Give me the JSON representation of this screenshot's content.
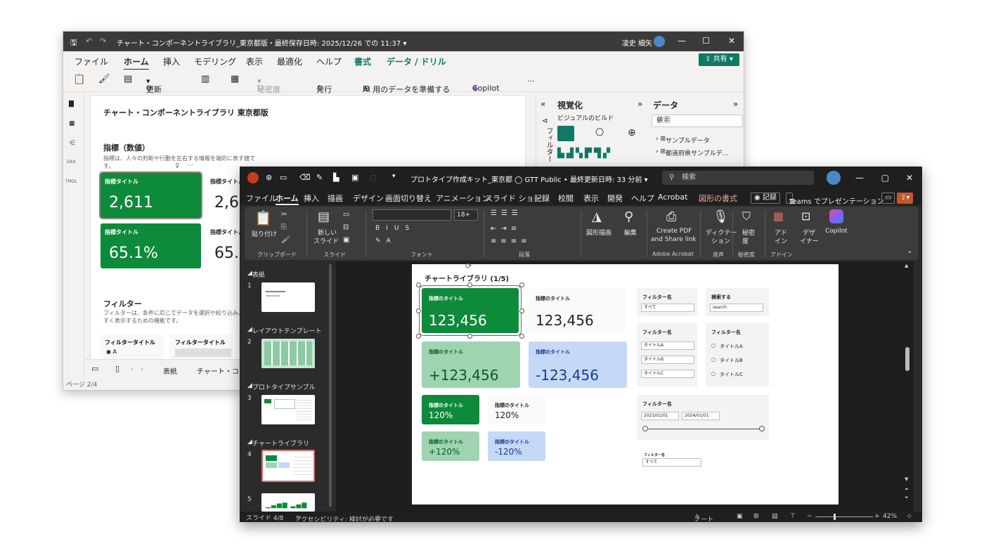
{
  "pbi": {
    "title": "チャート・コンポーネントライブラリ_東京都版・最終保存日時: 2025/12/26 での 11:37 ▾",
    "user": "凌史 細矢",
    "menu": [
      "ファイル",
      "ホーム",
      "挿入",
      "モデリング",
      "表示",
      "最適化",
      "ヘルプ",
      "書式",
      "データ / ドリル"
    ],
    "share": "共有",
    "ribbon": {
      "refresh": "更新",
      "sensitivity": "秘密度",
      "publish": "発行",
      "prepare_ai": "AI 用のデータを準備する",
      "copilot": "Copilot",
      "more": "···"
    },
    "left_nav": [
      "report-icon",
      "table-icon",
      "model-icon",
      "dax-icon",
      "tmdl-icon"
    ],
    "left_nav_labels": {
      "dax": "DAX",
      "tmdl": "TMDL"
    },
    "canvas": {
      "title": "チャート・コンポーネントライブラリ 東京都版",
      "kpi_heading": "指標（数値）",
      "kpi_desc": "指標は、人々の判断や行動を左右する情報を端的に表す値です。",
      "kpi_label": "指標タイトル",
      "kpi1_value": "2,611",
      "kpi2_value": "2,61",
      "kpi3_value": "65.1%",
      "kpi4_value": "65.1",
      "filter_heading": "フィルター",
      "filter_desc": "フィルターは、条件に応じてデータを選択や絞り込み、見やすく表示するための機能です。",
      "filter_title_1": "フィルタータイトル",
      "filter_title_2": "フィルタータイトル",
      "radio_a": "A",
      "visual_more": "···"
    },
    "right_panel": {
      "visual_title": "視覚化",
      "build_visual": "ビジュアルのビルド",
      "filter_vertical": "フィルター",
      "data_title": "データ",
      "search_placeholder": "検索",
      "tables": [
        "サンプルデータ",
        "都道府県サンプルデ..."
      ]
    },
    "bottom_tabs": [
      "表紙",
      "チャート・コン"
    ],
    "status": "ページ 2/4"
  },
  "ppt": {
    "title": "プロトタイプ作成キット_東京都  ◯ GTT Public • 最終更新日時: 33 分前 ▾",
    "search_placeholder": "検索",
    "menu": [
      "ファイル",
      "ホーム",
      "挿入",
      "描画",
      "デザイン",
      "画面切り替え",
      "アニメーション",
      "スライド ショー",
      "記録",
      "校閲",
      "表示",
      "開発",
      "ヘルプ",
      "Acrobat",
      "図形の書式"
    ],
    "record_btn": "◉ 記録",
    "teams_btn": "Teams でプレゼンテーション",
    "ribbon": {
      "paste": "貼り付け",
      "clipboard": "クリップボード",
      "new_slide_1": "新しい",
      "new_slide_2": "スライド",
      "slide_group": "スライド",
      "font_size": "18+",
      "font_group": "フォント",
      "paragraph_group": "段落",
      "shapes": "図形描画",
      "edit": "編集",
      "create_pdf_1": "Create PDF",
      "create_pdf_2": "and Share link",
      "adobe_group": "Adobe Acrobat",
      "dictate_1": "ディクテー",
      "dictate_2": "ション",
      "voice_group": "音声",
      "sensitivity_1": "秘密",
      "sensitivity_2": "度",
      "sensitivity_group": "秘密度",
      "addin_1": "アド",
      "addin_2": "イン",
      "addin_group": "アドイン",
      "designer_1": "デザ",
      "designer_2": "イナー",
      "copilot": "Copilot"
    },
    "sections": [
      {
        "name": "表紙",
        "slide": "1"
      },
      {
        "name": "レイアウトテンプレート",
        "slide": "2"
      },
      {
        "name": "プロトタイプサンプル",
        "slide": "3"
      },
      {
        "name": "チャートライブラリ",
        "slide": "4"
      },
      {
        "slide": "5"
      }
    ],
    "slide": {
      "title": "チャートライブラリ (1/5)",
      "kpi_label": "指標のタイトル",
      "k1": "123,456",
      "k2": "123,456",
      "k3": "+123,456",
      "k4": "-123,456",
      "k5": "120%",
      "k6": "120%",
      "k7": "+120%",
      "k8": "-120%",
      "filter_name": "フィルター名",
      "all": "すべて",
      "search_label": "検索する",
      "search_value": "search",
      "title_a": "タイトルA",
      "title_b": "タイトルB",
      "title_c": "タイトルC",
      "date_from": "2023/01/01",
      "date_to": "2024/01/01",
      "filter_name_small": "フィルター名"
    },
    "status": {
      "slide_count": "スライド 4/8",
      "accessibility": "アクセシビリティ: 検討が必要です",
      "notes": "ノート",
      "zoom": "42%"
    },
    "colors": {
      "green": "#0d8a3a",
      "light_green": "#9ed4b0",
      "light_blue": "#c5d8f7",
      "accent_red": "#d9534f"
    }
  }
}
